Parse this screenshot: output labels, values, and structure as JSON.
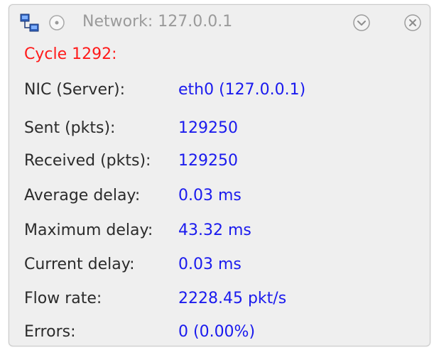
{
  "window": {
    "title": "Network: 127.0.0.1"
  },
  "cycle_label": "Cycle 1292:",
  "stats": [
    {
      "label": "NIC (Server):",
      "value": "eth0 (127.0.0.1)"
    },
    {
      "label": "Sent (pkts):",
      "value": "129250"
    },
    {
      "label": "Received (pkts):",
      "value": "129250"
    },
    {
      "label": "Average delay:",
      "value": "0.03 ms"
    },
    {
      "label": "Maximum delay:",
      "value": "43.32 ms"
    },
    {
      "label": "Current delay:",
      "value": "0.03 ms"
    },
    {
      "label": "Flow rate:",
      "value": "2228.45 pkt/s"
    },
    {
      "label": "Errors:",
      "value": "0 (0.00%)"
    }
  ],
  "colors": {
    "panel_bg": "#efefef",
    "title_text": "#9a9a9a",
    "cycle_text": "#ff1a1a",
    "label_text": "#2b2b2b",
    "value_text": "#1a1aee"
  },
  "icons": {
    "app": "network-icon",
    "status": "radio-icon",
    "collapse": "chevron-down-icon",
    "close": "close-icon"
  }
}
